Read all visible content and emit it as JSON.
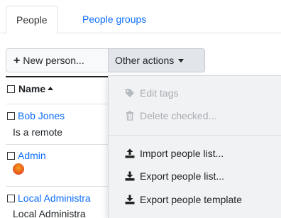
{
  "tabs": [
    {
      "label": "People",
      "active": true
    },
    {
      "label": "People groups",
      "active": false
    }
  ],
  "toolbar": {
    "new_person_label": "New person...",
    "other_actions_label": "Other actions"
  },
  "table": {
    "header_name": "Name",
    "rows": [
      {
        "name": "Bob Jones",
        "sub": "Is a remote"
      },
      {
        "name": "Admin",
        "sub_icon": "angry-face-icon"
      },
      {
        "name": "Local Administra",
        "sub": "Local Administra"
      }
    ]
  },
  "menu": {
    "items": [
      {
        "label": "Edit tags",
        "icon": "tag-icon",
        "enabled": false
      },
      {
        "label": "Delete checked...",
        "icon": "trash-icon",
        "enabled": false
      },
      {
        "label": "Import people list...",
        "icon": "upload-icon",
        "enabled": true
      },
      {
        "label": "Export people list...",
        "icon": "download-icon",
        "enabled": true
      },
      {
        "label": "Export people template",
        "icon": "download-icon",
        "enabled": true
      }
    ]
  },
  "colors": {
    "link": "#0d6efd",
    "disabled": "#a8adb3",
    "menu_bg": "#f1f2f3",
    "active_button_bg": "#e2e6ea"
  }
}
